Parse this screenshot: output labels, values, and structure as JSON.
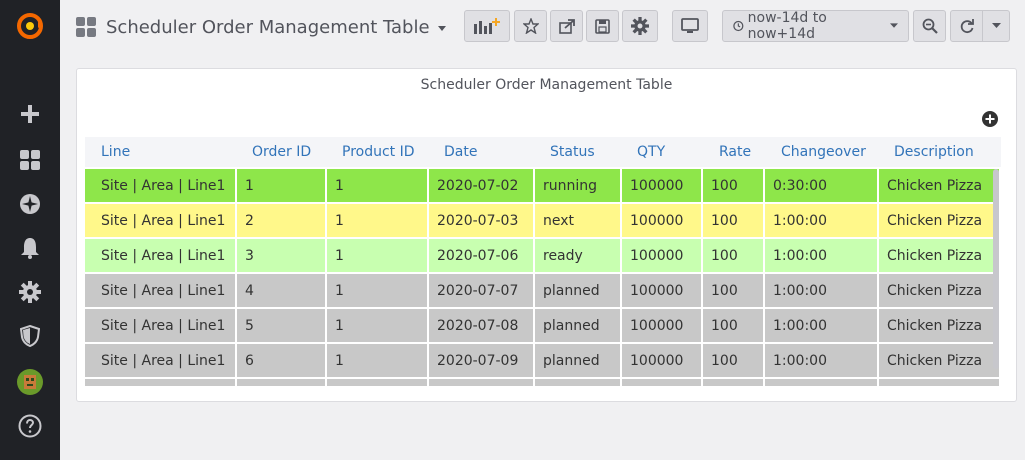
{
  "topbar": {
    "dashboard_title": "Scheduler Order Management Table",
    "time_range": "now-14d to now+14d"
  },
  "panel": {
    "title": "Scheduler Order Management Table"
  },
  "table": {
    "columns": [
      "Line",
      "Order ID",
      "Product ID",
      "Date",
      "Status",
      "QTY",
      "Rate",
      "Changeover",
      "Description"
    ],
    "rows": [
      {
        "bg": "#8ee64a",
        "cells": [
          "Site | Area | Line1",
          "1",
          "1",
          "2020-07-02",
          "running",
          "100000",
          "100",
          "0:30:00",
          "Chicken Pizza"
        ]
      },
      {
        "bg": "#fff88a",
        "cells": [
          "Site | Area | Line1",
          "2",
          "1",
          "2020-07-03",
          "next",
          "100000",
          "100",
          "1:00:00",
          "Chicken Pizza"
        ]
      },
      {
        "bg": "#c8ffb0",
        "cells": [
          "Site | Area | Line1",
          "3",
          "1",
          "2020-07-06",
          "ready",
          "100000",
          "100",
          "1:00:00",
          "Chicken Pizza"
        ]
      },
      {
        "bg": "#c8c8c8",
        "cells": [
          "Site | Area | Line1",
          "4",
          "1",
          "2020-07-07",
          "planned",
          "100000",
          "100",
          "1:00:00",
          "Chicken Pizza"
        ]
      },
      {
        "bg": "#c8c8c8",
        "cells": [
          "Site | Area | Line1",
          "5",
          "1",
          "2020-07-08",
          "planned",
          "100000",
          "100",
          "1:00:00",
          "Chicken Pizza"
        ]
      },
      {
        "bg": "#c8c8c8",
        "cells": [
          "Site | Area | Line1",
          "6",
          "1",
          "2020-07-09",
          "planned",
          "100000",
          "100",
          "1:00:00",
          "Chicken Pizza"
        ]
      },
      {
        "bg": "#c8c8c8",
        "cells": [
          "",
          "",
          "",
          "",
          "",
          "",
          "",
          "",
          ""
        ]
      }
    ]
  },
  "colors": {
    "sidebar": "#202226",
    "header_text": "#3274b9",
    "running": "#8ee64a",
    "next": "#fff88a",
    "ready": "#c8ffb0",
    "planned": "#c8c8c8"
  },
  "icons": {
    "sidebar": [
      "grafana-logo-icon",
      "plus-icon",
      "dashboards-icon",
      "compass-icon",
      "bell-icon",
      "gear-icon",
      "shield-icon",
      "avatar",
      "help-icon"
    ],
    "toolbar": [
      "add-panel-icon",
      "star-icon",
      "share-icon",
      "save-icon",
      "gear-icon",
      "tv-icon",
      "clock-icon",
      "zoom-out-icon",
      "refresh-icon",
      "chevron-down-icon"
    ]
  }
}
